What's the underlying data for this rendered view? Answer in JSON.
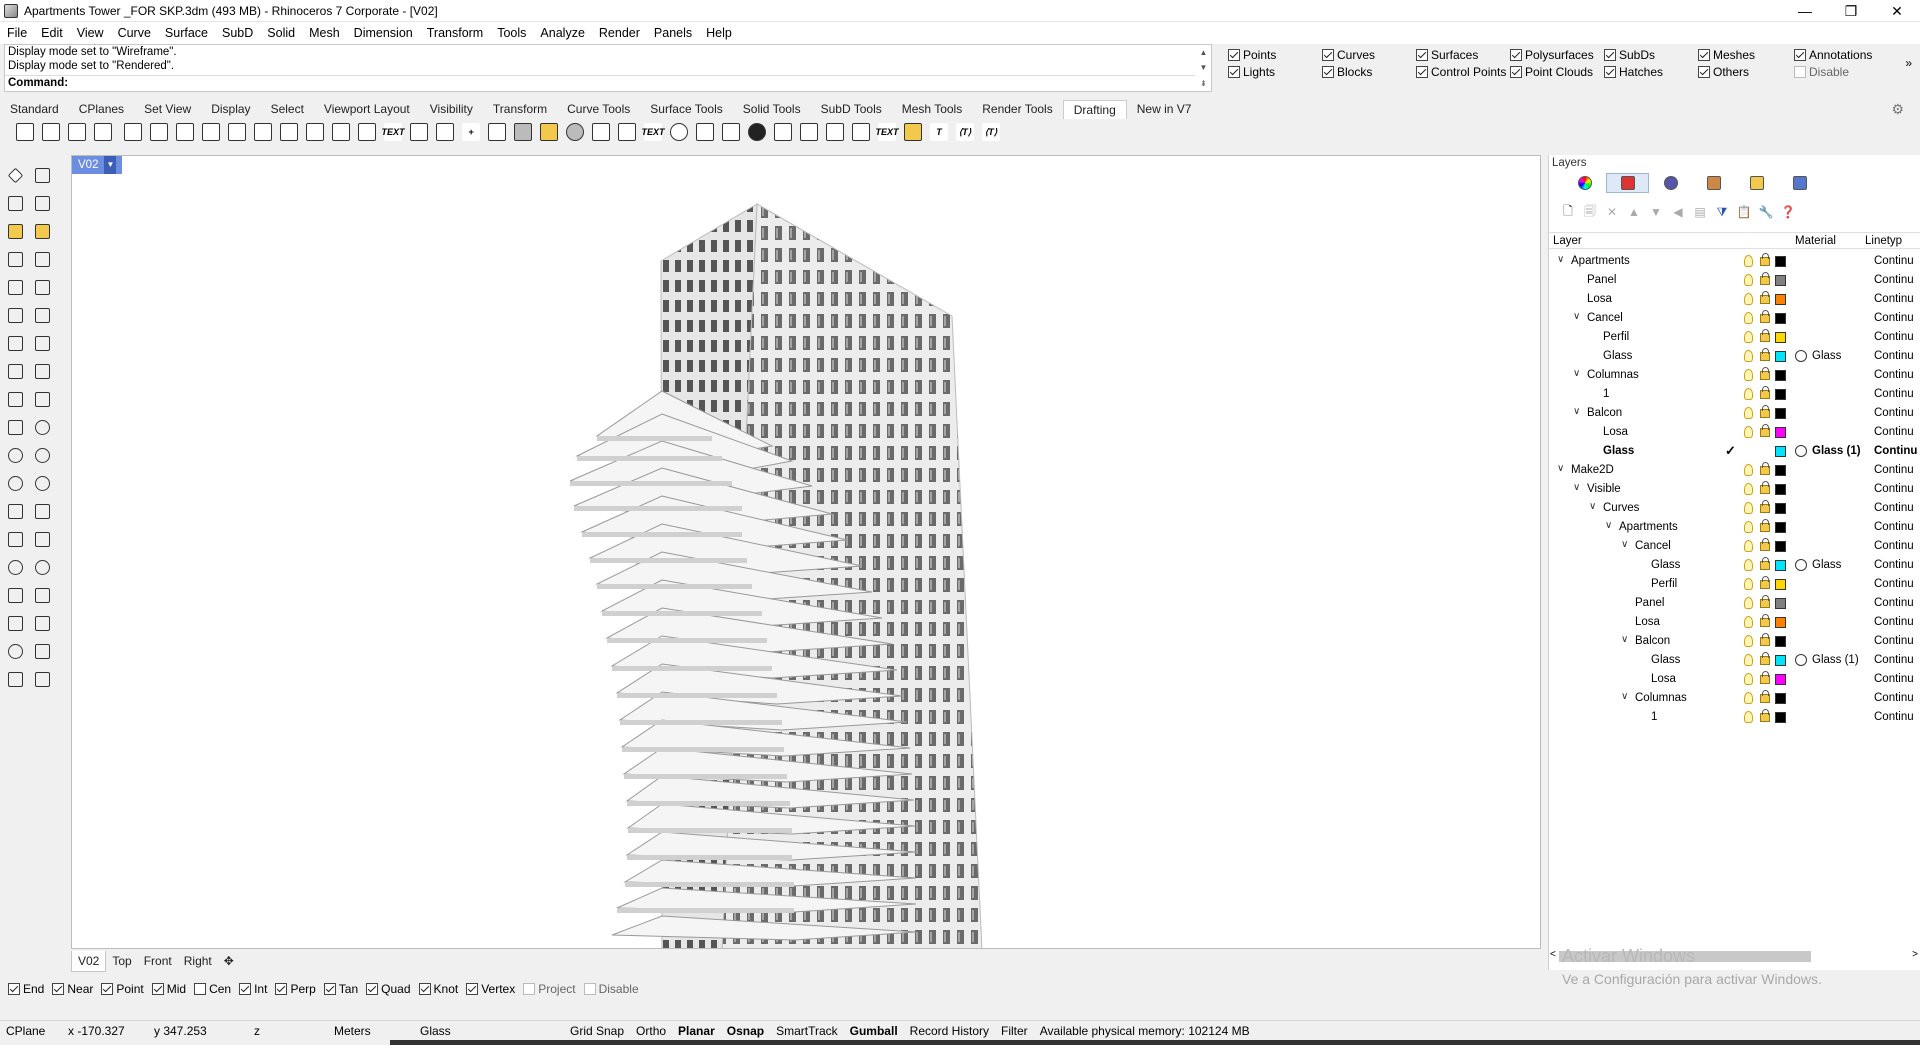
{
  "window": {
    "title": "Apartments Tower _FOR SKP.3dm (493 MB) - Rhinoceros 7 Corporate - [V02]",
    "controls": [
      "—",
      "❐",
      "✕"
    ]
  },
  "menu": [
    "File",
    "Edit",
    "View",
    "Curve",
    "Surface",
    "SubD",
    "Solid",
    "Mesh",
    "Dimension",
    "Transform",
    "Tools",
    "Analyze",
    "Render",
    "Panels",
    "Help"
  ],
  "command": {
    "history": [
      "Display mode set to \"Wireframe\".",
      "Display mode set to \"Rendered\"."
    ],
    "prompt": "Command:",
    "value": ""
  },
  "filters": [
    {
      "label": "Points",
      "checked": true
    },
    {
      "label": "Curves",
      "checked": true
    },
    {
      "label": "Surfaces",
      "checked": true
    },
    {
      "label": "Polysurfaces",
      "checked": true
    },
    {
      "label": "SubDs",
      "checked": true
    },
    {
      "label": "Meshes",
      "checked": true
    },
    {
      "label": "Annotations",
      "checked": true
    },
    {
      "label": "Lights",
      "checked": true
    },
    {
      "label": "Blocks",
      "checked": true
    },
    {
      "label": "Control Points",
      "checked": true
    },
    {
      "label": "Point Clouds",
      "checked": true
    },
    {
      "label": "Hatches",
      "checked": true
    },
    {
      "label": "Others",
      "checked": true
    },
    {
      "label": "Disable",
      "checked": false
    }
  ],
  "filters_more": "»",
  "tabs": [
    "Standard",
    "CPlanes",
    "Set View",
    "Display",
    "Select",
    "Viewport Layout",
    "Visibility",
    "Transform",
    "Curve Tools",
    "Surface Tools",
    "Solid Tools",
    "SubD Tools",
    "Mesh Tools",
    "Render Tools",
    "Drafting",
    "New in V7"
  ],
  "active_tab": "Drafting",
  "viewport": {
    "name": "V02",
    "dropdown": "▼"
  },
  "viewport_tabs": [
    "V02",
    "Top",
    "Front",
    "Right",
    "✥"
  ],
  "osnaps": [
    {
      "label": "End",
      "checked": true
    },
    {
      "label": "Near",
      "checked": true
    },
    {
      "label": "Point",
      "checked": true
    },
    {
      "label": "Mid",
      "checked": true
    },
    {
      "label": "Cen",
      "checked": false
    },
    {
      "label": "Int",
      "checked": true
    },
    {
      "label": "Perp",
      "checked": true
    },
    {
      "label": "Tan",
      "checked": true
    },
    {
      "label": "Quad",
      "checked": true
    },
    {
      "label": "Knot",
      "checked": true
    },
    {
      "label": "Vertex",
      "checked": true
    },
    {
      "label": "Project",
      "checked": false
    },
    {
      "label": "Disable",
      "checked": false
    }
  ],
  "status": {
    "cplane": "CPlane",
    "x": "x -170.327",
    "y": "y 347.253",
    "z": "z",
    "units": "Meters",
    "layer": "Glass",
    "grid_snap": "Grid Snap",
    "ortho": "Ortho",
    "planar": "Planar",
    "osnap": "Osnap",
    "smarttrack": "SmartTrack",
    "gumball": "Gumball",
    "record_history": "Record History",
    "filter": "Filter",
    "memory": "Available physical memory: 102124 MB"
  },
  "layers_panel": {
    "title": "Layers",
    "columns": {
      "layer": "Layer",
      "material": "Material",
      "linetype": "Linetyp"
    },
    "rows": [
      {
        "name": "Apartments",
        "depth": 0,
        "expand": "v",
        "color": "#000000",
        "material": "",
        "bold": false,
        "current": false
      },
      {
        "name": "Panel",
        "depth": 1,
        "expand": "",
        "color": "#808080",
        "material": "",
        "bold": false,
        "current": false
      },
      {
        "name": "Losa",
        "depth": 1,
        "expand": "",
        "color": "#ff8000",
        "material": "",
        "bold": false,
        "current": false
      },
      {
        "name": "Cancel",
        "depth": 1,
        "expand": "v",
        "color": "#000000",
        "material": "",
        "bold": false,
        "current": false
      },
      {
        "name": "Perfil",
        "depth": 2,
        "expand": "",
        "color": "#ffd700",
        "material": "",
        "bold": false,
        "current": false
      },
      {
        "name": "Glass",
        "depth": 2,
        "expand": "",
        "color": "#00e5ff",
        "material": "Glass",
        "bold": false,
        "current": false
      },
      {
        "name": "Columnas",
        "depth": 1,
        "expand": "v",
        "color": "#000000",
        "material": "",
        "bold": false,
        "current": false
      },
      {
        "name": "1",
        "depth": 2,
        "expand": "",
        "color": "#000000",
        "material": "",
        "bold": false,
        "current": false
      },
      {
        "name": "Balcon",
        "depth": 1,
        "expand": "v",
        "color": "#000000",
        "material": "",
        "bold": false,
        "current": false
      },
      {
        "name": "Losa",
        "depth": 2,
        "expand": "",
        "color": "#ff00ff",
        "material": "",
        "bold": false,
        "current": false
      },
      {
        "name": "Glass",
        "depth": 2,
        "expand": "",
        "color": "#00e5ff",
        "material": "Glass (1)",
        "bold": true,
        "current": true
      },
      {
        "name": "Make2D",
        "depth": 0,
        "expand": "v",
        "color": "#000000",
        "material": "",
        "bold": false,
        "current": false
      },
      {
        "name": "Visible",
        "depth": 1,
        "expand": "v",
        "color": "#000000",
        "material": "",
        "bold": false,
        "current": false
      },
      {
        "name": "Curves",
        "depth": 2,
        "expand": "v",
        "color": "#000000",
        "material": "",
        "bold": false,
        "current": false
      },
      {
        "name": "Apartments",
        "depth": 3,
        "expand": "v",
        "color": "#000000",
        "material": "",
        "bold": false,
        "current": false
      },
      {
        "name": "Cancel",
        "depth": 4,
        "expand": "v",
        "color": "#000000",
        "material": "",
        "bold": false,
        "current": false
      },
      {
        "name": "Glass",
        "depth": 5,
        "expand": "",
        "color": "#00e5ff",
        "material": "Glass",
        "bold": false,
        "current": false
      },
      {
        "name": "Perfil",
        "depth": 5,
        "expand": "",
        "color": "#ffd700",
        "material": "",
        "bold": false,
        "current": false
      },
      {
        "name": "Panel",
        "depth": 4,
        "expand": "",
        "color": "#808080",
        "material": "",
        "bold": false,
        "current": false
      },
      {
        "name": "Losa",
        "depth": 4,
        "expand": "",
        "color": "#ff8000",
        "material": "",
        "bold": false,
        "current": false
      },
      {
        "name": "Balcon",
        "depth": 4,
        "expand": "v",
        "color": "#000000",
        "material": "",
        "bold": false,
        "current": false
      },
      {
        "name": "Glass",
        "depth": 5,
        "expand": "",
        "color": "#00e5ff",
        "material": "Glass (1)",
        "bold": false,
        "current": false
      },
      {
        "name": "Losa",
        "depth": 5,
        "expand": "",
        "color": "#ff00ff",
        "material": "",
        "bold": false,
        "current": false
      },
      {
        "name": "Columnas",
        "depth": 4,
        "expand": "v",
        "color": "#000000",
        "material": "",
        "bold": false,
        "current": false
      },
      {
        "name": "1",
        "depth": 5,
        "expand": "",
        "color": "#000000",
        "material": "",
        "bold": false,
        "current": false
      }
    ],
    "linetype_value": "Continu",
    "current_mark": "✓"
  },
  "watermark": {
    "line1": "Activar Windows",
    "line2": "Ve a Configuración para activar Windows."
  },
  "colors": {
    "viewport_tab": "#6b8ee0",
    "panel_tab_active": "#dfe8f6"
  }
}
